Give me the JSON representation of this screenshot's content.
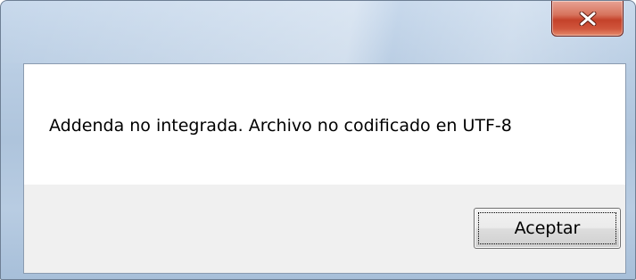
{
  "window": {
    "close_icon": "close-x-icon",
    "accent_color": "#c4422a"
  },
  "dialog": {
    "message": "Addenda no integrada. Archivo no codificado en UTF-8",
    "ok_label": "Aceptar"
  }
}
